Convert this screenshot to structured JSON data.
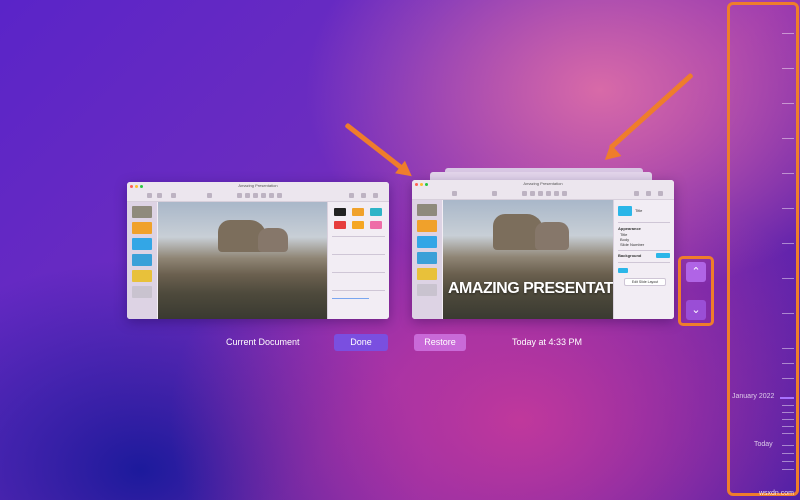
{
  "left_window": {
    "title": "Amazing Presentation",
    "inspector": {
      "swatch_label": "TEXT",
      "section_title": "Shape Styles"
    }
  },
  "right_window": {
    "title": "Amazing Presentation",
    "slide_title": "AMAZING PRESENTATION",
    "inspector": {
      "layout_label": "Title",
      "appearance_title": "Appearance",
      "options": [
        "Title",
        "Body",
        "Slide Number"
      ],
      "background_title": "Background",
      "edit_button": "Edit Slide Layout"
    }
  },
  "labels": {
    "current_document": "Current Document",
    "done_button": "Done",
    "restore_button": "Restore",
    "version_timestamp": "Today at 4:33 PM"
  },
  "navigation": {
    "up_icon": "chevron-up-icon",
    "down_icon": "chevron-down-icon"
  },
  "timeline": {
    "labels": [
      "January 2022",
      "Today"
    ]
  },
  "watermark": "wsxdn.com",
  "colors": {
    "accent": "#ef7d2b",
    "done_button": "#7a4fe0",
    "restore_button": "#c96ad8",
    "nav_button": "#b064e6",
    "timeline_highlight": "#a872ff"
  }
}
